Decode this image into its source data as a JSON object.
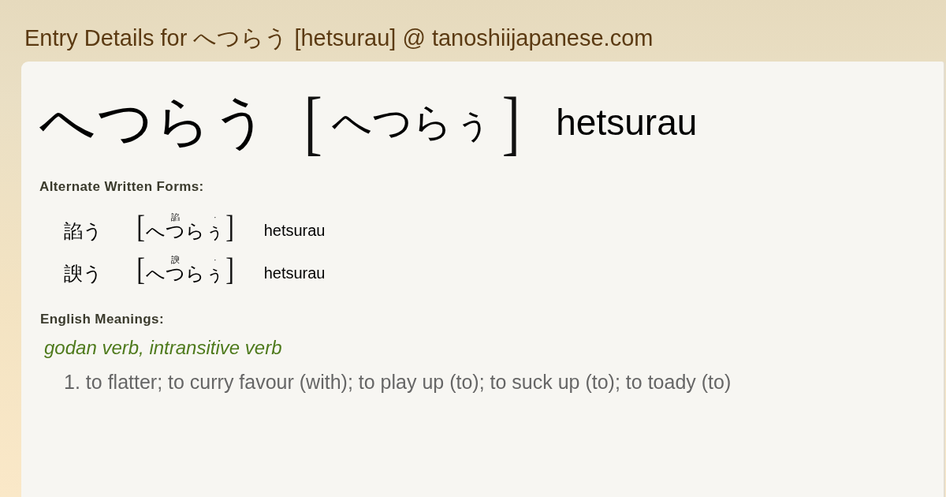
{
  "page_title": "Entry Details for へつらう [hetsurau] @ tanoshiijapanese.com",
  "entry": {
    "word": "へつらう",
    "reading_open": "[",
    "reading": "へつらぅ",
    "reading_close": "]",
    "romaji": "hetsurau"
  },
  "alternate_forms": {
    "heading": "Alternate Written Forms:",
    "items": [
      {
        "written": "諂う",
        "open": "[",
        "furigana": [
          {
            "base": "へつら",
            "ruby": "諂"
          },
          {
            "base": "ぅ",
            "ruby": "·"
          }
        ],
        "close": "]",
        "romaji": "hetsurau"
      },
      {
        "written": "諛う",
        "open": "[",
        "furigana": [
          {
            "base": "へつら",
            "ruby": "諛"
          },
          {
            "base": "ぅ",
            "ruby": "·"
          }
        ],
        "close": "]",
        "romaji": "hetsurau"
      }
    ]
  },
  "meanings": {
    "heading": "English Meanings:",
    "part_of_speech": "godan verb, intransitive verb",
    "senses": [
      {
        "number": "1.",
        "text": "to flatter; to curry favour (with); to play up (to); to suck up (to); to toady (to)"
      }
    ]
  }
}
